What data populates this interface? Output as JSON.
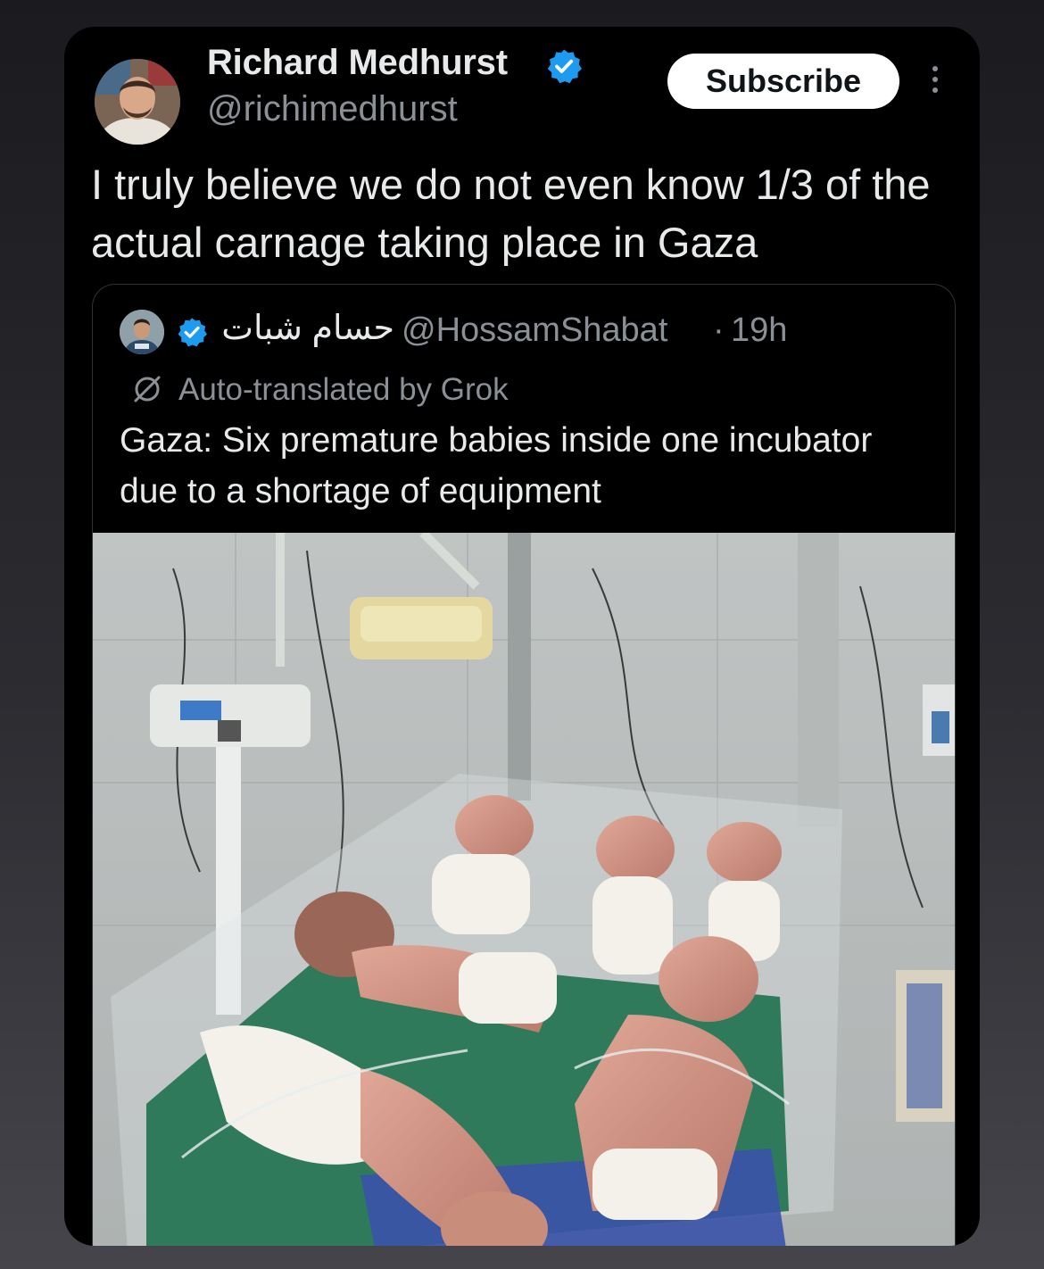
{
  "post": {
    "author_name": "Richard Medhurst",
    "author_handle": "@richimedhurst",
    "subscribe_label": "Subscribe",
    "text": "I truly believe we do not even know 1/3 of the actual carnage taking place in Gaza"
  },
  "quoted_post": {
    "author_name": "حسام شبات",
    "author_handle": "@HossamShabat",
    "separator": "·",
    "time": "19h",
    "translation_note": "Auto-translated by Grok",
    "text": "Gaza: Six premature babies inside one incubator due to a shortage of equipment"
  },
  "colors": {
    "background": "#000000",
    "text_primary": "#e7e9ea",
    "text_secondary": "#8b9096",
    "verified_blue": "#1d9bf0",
    "subscribe_bg": "#ffffff"
  },
  "icons": [
    "verified-badge-icon",
    "more-options-icon",
    "grok-icon"
  ]
}
